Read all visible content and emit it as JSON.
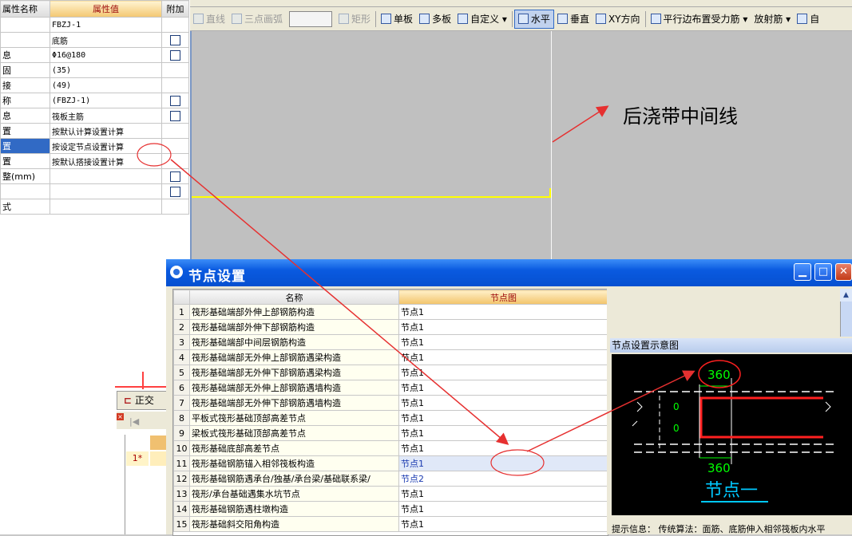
{
  "property_panel": {
    "col_name": "属性名称",
    "col_value": "属性值",
    "col_extra": "附加",
    "rows": [
      {
        "name": "",
        "value": "FBZJ-1",
        "check": false
      },
      {
        "name": "",
        "value": "底筋",
        "check": true
      },
      {
        "name": "息",
        "value": "Φ16@180",
        "check": true
      },
      {
        "name": "固",
        "value": "(35)",
        "check": false
      },
      {
        "name": "接",
        "value": "(49)",
        "check": false
      },
      {
        "name": "称",
        "value": "(FBZJ-1)",
        "check": true
      },
      {
        "name": "息",
        "value": "筏板主筋",
        "check": true
      },
      {
        "name": "置",
        "value": "按默认计算设置计算",
        "check": false
      },
      {
        "name": "置",
        "value": "按设定节点设置计算",
        "check": false,
        "selected": true
      },
      {
        "name": "置",
        "value": "按默认搭接设置计算",
        "check": false
      },
      {
        "name": "整(mm)",
        "value": "",
        "check": true
      },
      {
        "name": "",
        "value": "",
        "check": true
      },
      {
        "name": "式",
        "value": "",
        "check": false
      }
    ]
  },
  "bottom_left": {
    "tab_label": "正交",
    "row_label": "1*"
  },
  "toolbar": {
    "items": [
      {
        "icon": "line-icon",
        "label": "直线",
        "disabled": true
      },
      {
        "icon": "arc-icon",
        "label": "三点画弧",
        "disabled": true
      },
      {
        "icon": "combo",
        "label": ""
      },
      {
        "icon": "rect-icon",
        "label": "矩形",
        "disabled": true
      },
      {
        "icon": "single-board-icon",
        "label": "单板"
      },
      {
        "icon": "multi-board-icon",
        "label": "多板"
      },
      {
        "icon": "custom-icon",
        "label": "自定义 ▾"
      },
      {
        "icon": "horizontal-icon",
        "label": "水平",
        "active": true
      },
      {
        "icon": "vertical-icon",
        "label": "垂直"
      },
      {
        "icon": "xy-direction-icon",
        "label": "XY方向"
      },
      {
        "icon": "parallel-edge-icon",
        "label": "平行边布置受力筋 ▾"
      },
      {
        "icon": "",
        "label": "放射筋 ▾"
      },
      {
        "icon": "more-icon",
        "label": "自"
      }
    ]
  },
  "canvas": {
    "annotation": "后浇带中间线"
  },
  "dialog": {
    "title": "节点设置",
    "col_name": "名称",
    "col_node": "节点图",
    "rows": [
      {
        "n": "1",
        "name": "筏形基础端部外伸上部钢筋构造",
        "node": "节点1"
      },
      {
        "n": "2",
        "name": "筏形基础端部外伸下部钢筋构造",
        "node": "节点1"
      },
      {
        "n": "3",
        "name": "筏形基础端部中间层钢筋构造",
        "node": "节点1"
      },
      {
        "n": "4",
        "name": "筏形基础端部无外伸上部钢筋遇梁构造",
        "node": "节点1"
      },
      {
        "n": "5",
        "name": "筏形基础端部无外伸下部钢筋遇梁构造",
        "node": "节点1"
      },
      {
        "n": "6",
        "name": "筏形基础端部无外伸上部钢筋遇墙构造",
        "node": "节点1"
      },
      {
        "n": "7",
        "name": "筏形基础端部无外伸下部钢筋遇墙构造",
        "node": "节点1"
      },
      {
        "n": "8",
        "name": "平板式筏形基础顶部高差节点",
        "node": "节点1"
      },
      {
        "n": "9",
        "name": "梁板式筏形基础顶部高差节点",
        "node": "节点1"
      },
      {
        "n": "10",
        "name": "筏形基础底部高差节点",
        "node": "节点1"
      },
      {
        "n": "11",
        "name": "筏形基础钢筋锚入相邻筏板构造",
        "node": "节点1",
        "selected": true
      },
      {
        "n": "12",
        "name": "筏形基础钢筋遇承台/独基/承台梁/基础联系梁/",
        "node": "节点2",
        "blue": true
      },
      {
        "n": "13",
        "name": "筏形/承台基础遇集水坑节点",
        "node": "节点1"
      },
      {
        "n": "14",
        "name": "筏形基础钢筋遇柱墩构造",
        "node": "节点1"
      },
      {
        "n": "15",
        "name": "筏形基础斜交阳角构造",
        "node": "节点1"
      }
    ],
    "preview_title": "节点设置示意图",
    "preview": {
      "dim_top": "360",
      "dim_bottom": "360",
      "left_label": "0",
      "left_label2": "0",
      "caption": "节点一"
    },
    "hint": "提示信息： 传统算法：面筋、底筋伸入相邻筏板内水平"
  },
  "colors": {
    "annotation_red": "#e63030",
    "cad_yellow": "#ffff00",
    "preview_green": "#00ff00",
    "preview_red": "#ff2020",
    "preview_caption": "#00c8ff"
  }
}
